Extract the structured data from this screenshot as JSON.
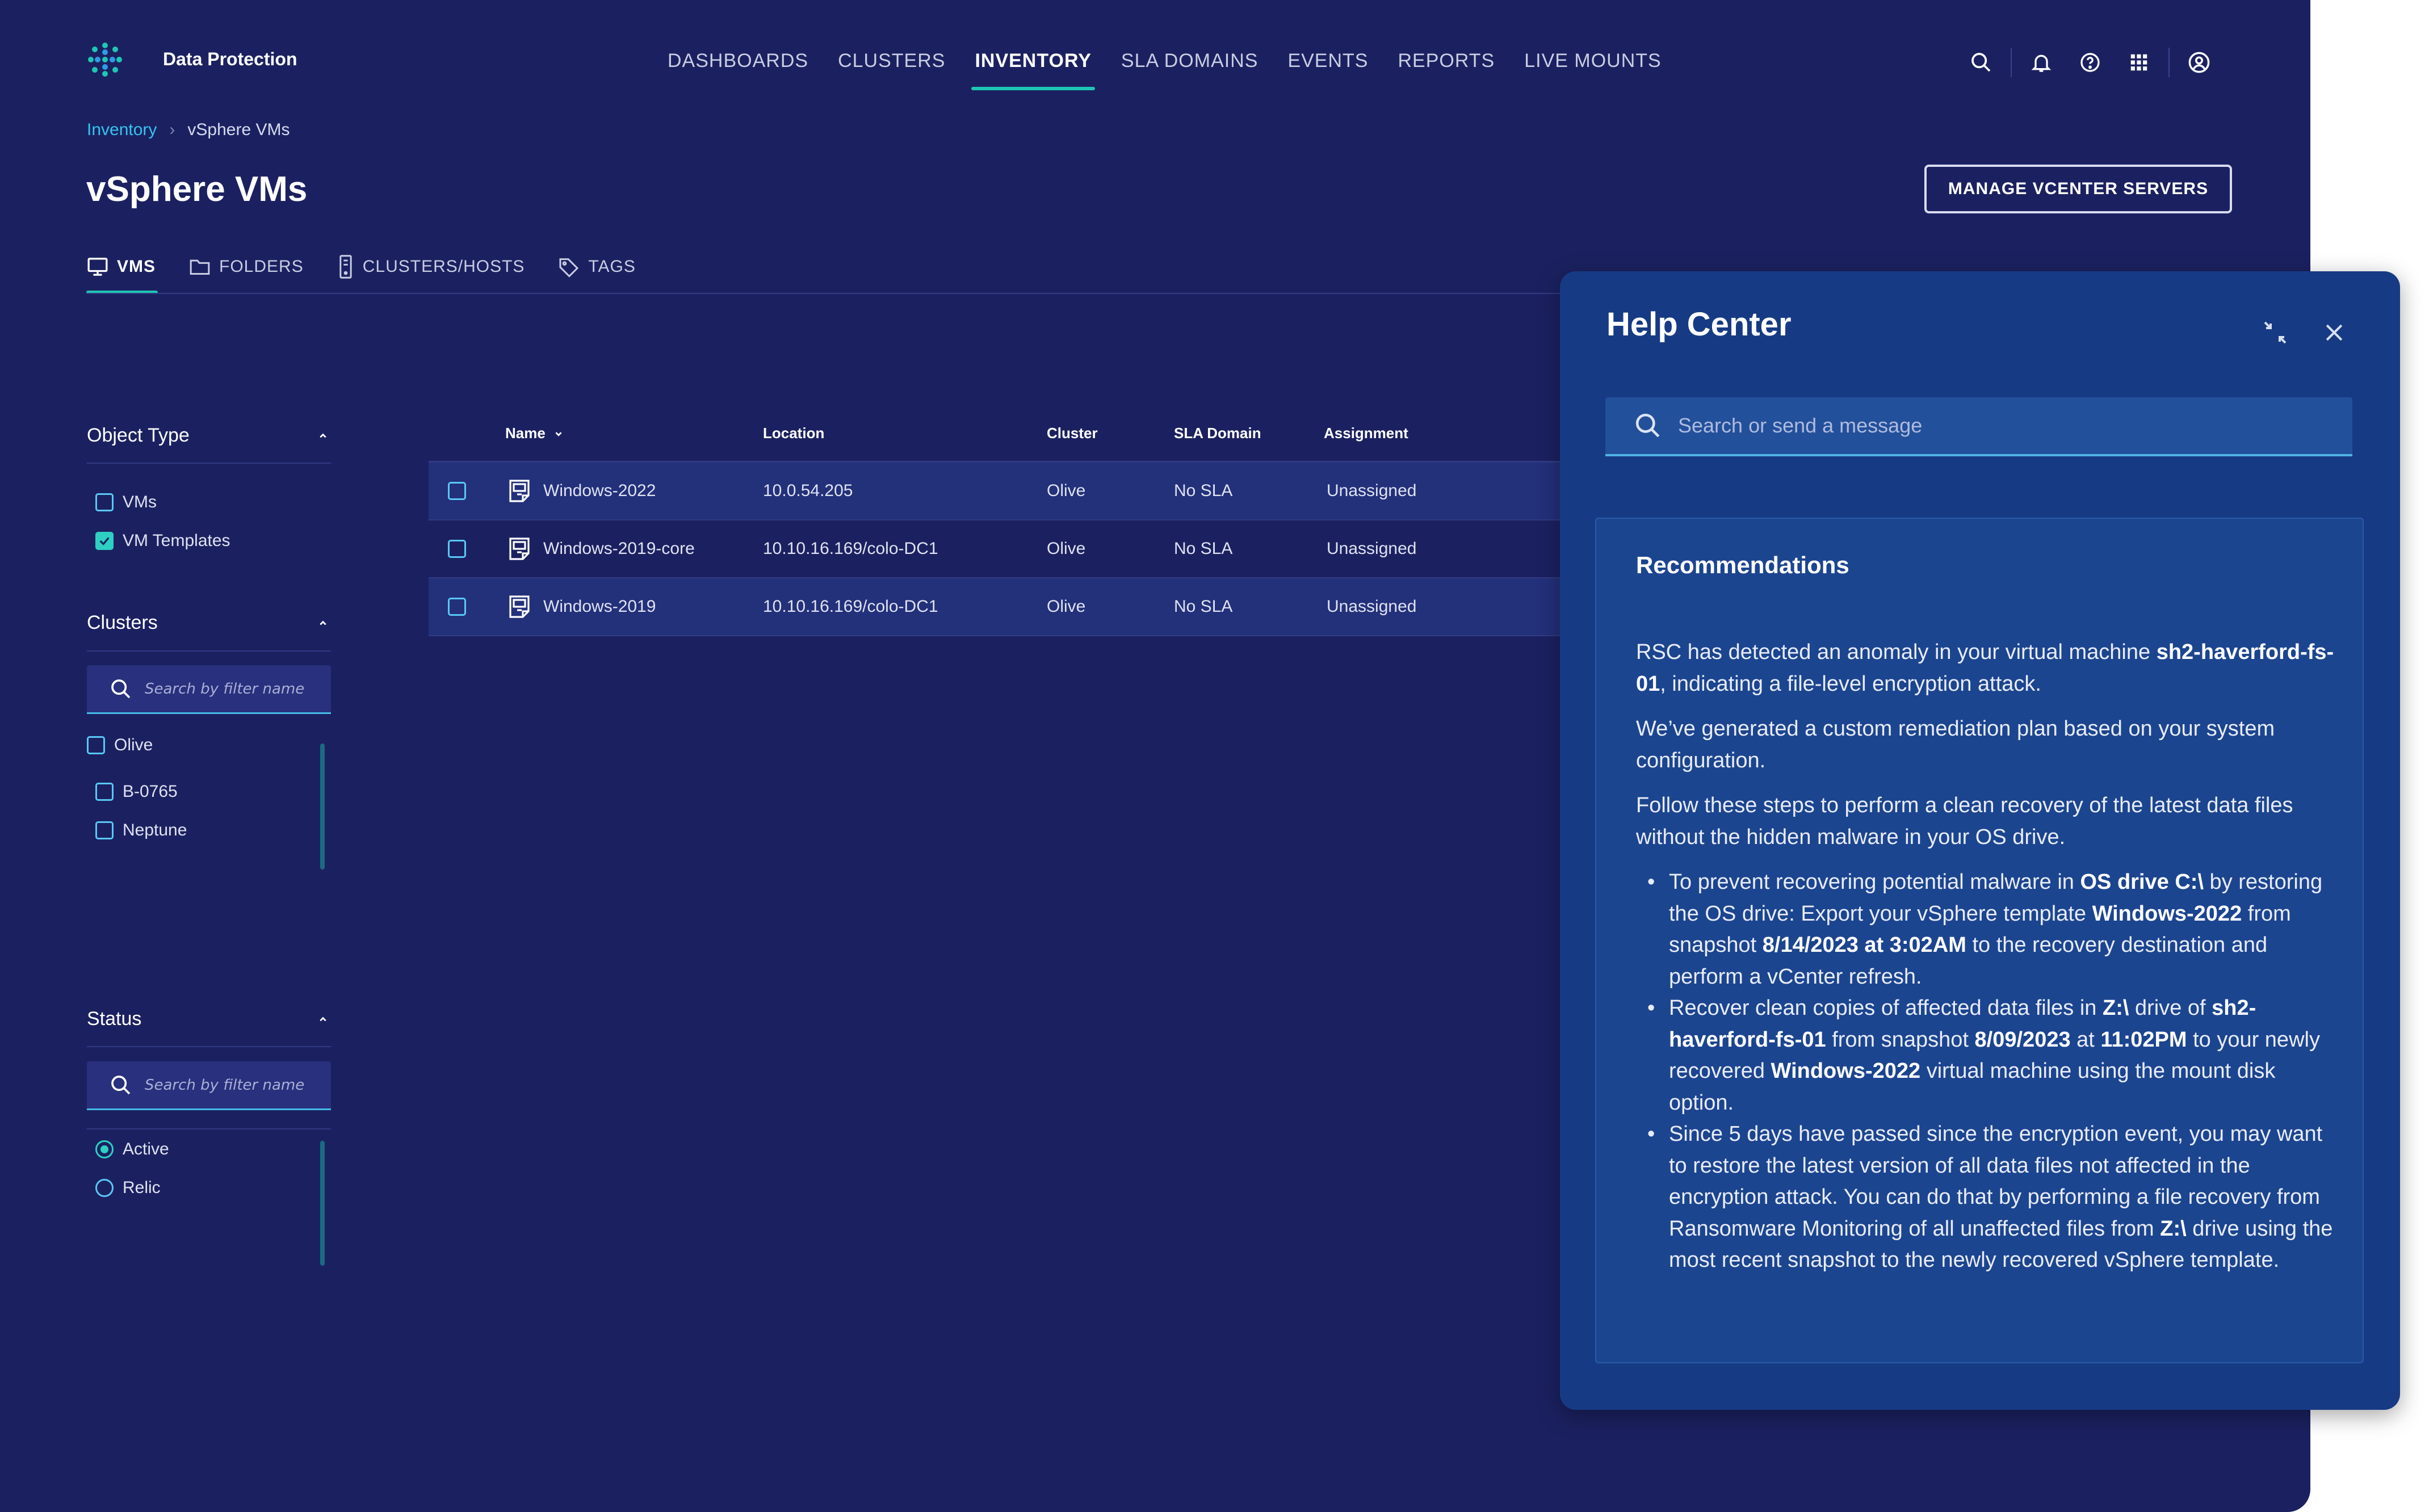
{
  "app": {
    "brand": "Data Protection"
  },
  "topnav": [
    {
      "label": "DASHBOARDS",
      "active": false
    },
    {
      "label": "CLUSTERS",
      "active": false
    },
    {
      "label": "INVENTORY",
      "active": true
    },
    {
      "label": "SLA DOMAINS",
      "active": false
    },
    {
      "label": "EVENTS",
      "active": false
    },
    {
      "label": "REPORTS",
      "active": false
    },
    {
      "label": "LIVE MOUNTS",
      "active": false
    }
  ],
  "breadcrumb": {
    "parent": "Inventory",
    "separator": "›",
    "current": "vSphere VMs"
  },
  "page": {
    "title": "vSphere VMs",
    "manage_button": "MANAGE VCENTER SERVERS"
  },
  "tabs": [
    {
      "label": "VMS",
      "icon": "monitor-icon",
      "active": true
    },
    {
      "label": "FOLDERS",
      "icon": "folder-icon",
      "active": false
    },
    {
      "label": "CLUSTERS/HOSTS",
      "icon": "server-icon",
      "active": false
    },
    {
      "label": "TAGS",
      "icon": "tag-icon",
      "active": false
    }
  ],
  "filters": {
    "object_type": {
      "title": "Object Type",
      "options": [
        {
          "label": "VMs",
          "checked": false
        },
        {
          "label": "VM Templates",
          "checked": true
        }
      ]
    },
    "clusters": {
      "title": "Clusters",
      "search_placeholder": "Search by filter name",
      "options": [
        {
          "label": "Olive",
          "checked": false
        },
        {
          "label": "B-0765",
          "checked": false
        },
        {
          "label": "Neptune",
          "checked": false
        }
      ]
    },
    "status": {
      "title": "Status",
      "search_placeholder": "Search by filter name",
      "options": [
        {
          "label": "Active",
          "checked": true
        },
        {
          "label": "Relic",
          "checked": false
        }
      ]
    }
  },
  "table": {
    "columns": [
      "Name",
      "Location",
      "Cluster",
      "SLA Domain",
      "Assignment"
    ],
    "rows": [
      {
        "name": "Windows-2022",
        "location": "10.0.54.205",
        "cluster": "Olive",
        "sla": "No SLA",
        "assignment": "Unassigned"
      },
      {
        "name": "Windows-2019-core",
        "location": "10.10.16.169/colo-DC1",
        "cluster": "Olive",
        "sla": "No SLA",
        "assignment": "Unassigned"
      },
      {
        "name": "Windows-2019",
        "location": "10.10.16.169/colo-DC1",
        "cluster": "Olive",
        "sla": "No SLA",
        "assignment": "Unassigned"
      }
    ]
  },
  "help": {
    "title": "Help Center",
    "search_placeholder": "Search or send a message",
    "recommendations": {
      "title": "Recommendations",
      "p1_a": "RSC has detected an anomaly in your virtual machine ",
      "p1_b": "sh2-haverford-fs-01",
      "p1_c": ", indicating a file-level encryption attack.",
      "p2": "We’ve generated a custom remediation plan based on your system configuration.",
      "p3": "Follow these steps to perform a clean recovery of the latest data files without the hidden malware in your OS drive.",
      "b1_a": "To prevent recovering potential malware in ",
      "b1_b": "OS drive C:\\",
      "b1_c": " by restoring the OS drive: Export your vSphere template ",
      "b1_d": "Windows-2022",
      "b1_e": " from snapshot ",
      "b1_f": "8/14/2023 at 3:02AM",
      "b1_g": " to the recovery destination and perform a vCenter refresh.",
      "b2_a": "Recover clean copies of affected data files in ",
      "b2_b": "Z:\\",
      "b2_c": " drive of ",
      "b2_d": "sh2-haverford-fs-01",
      "b2_e": " from snapshot ",
      "b2_f": "8/09/2023",
      "b2_g": " at ",
      "b2_h": "11:02PM",
      "b2_i": " to your newly recovered ",
      "b2_j": "Windows-2022",
      "b2_k": " virtual machine using the mount disk option.",
      "b3_a": "Since 5 days have passed since the encryption event, you may want to restore the latest version of all data files not affected in the encryption attack. You can do that by performing a file recovery from Ransomware Monitoring of all unaffected files from ",
      "b3_b": "Z:\\",
      "b3_c": " drive using the most recent snapshot to the newly recovered vSphere template."
    }
  },
  "colors": {
    "background": "#1b2160",
    "accent": "#1fc6b4",
    "link": "#36c3f0",
    "panel": "#173a84"
  }
}
